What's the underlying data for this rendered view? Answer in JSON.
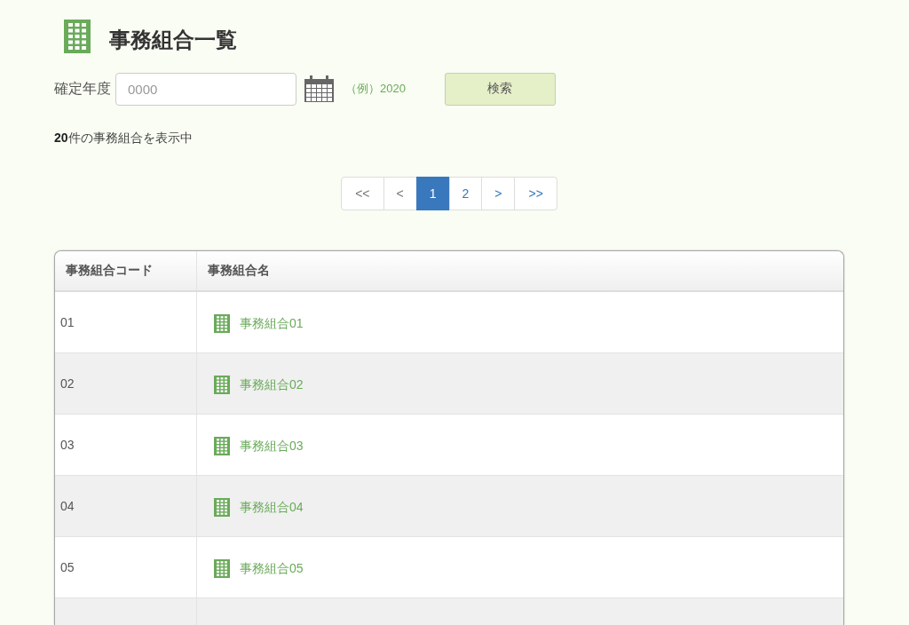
{
  "page": {
    "title": "事務組合一覧"
  },
  "search": {
    "label": "確定年度",
    "placeholder": "0000",
    "example": "（例）2020",
    "button": "検索"
  },
  "result_summary": "**20**件の事務組合を表示中",
  "pagination": [
    {
      "label": "<<",
      "selected": false,
      "disabled": true
    },
    {
      "label": "<",
      "selected": false,
      "disabled": true
    },
    {
      "label": "1",
      "selected": true,
      "disabled": false
    },
    {
      "label": "2",
      "selected": false,
      "disabled": false
    },
    {
      "label": ">",
      "selected": false,
      "disabled": false
    },
    {
      "label": ">>",
      "selected": false,
      "disabled": false
    }
  ],
  "table": {
    "columns": [
      "事務組合コード",
      "事務組合名"
    ],
    "rows": [
      {
        "code": "01",
        "name": "事務組合01"
      },
      {
        "code": "02",
        "name": "事務組合02"
      },
      {
        "code": "03",
        "name": "事務組合03"
      },
      {
        "code": "04",
        "name": "事務組合04"
      },
      {
        "code": "05",
        "name": "事務組合05"
      }
    ]
  }
}
